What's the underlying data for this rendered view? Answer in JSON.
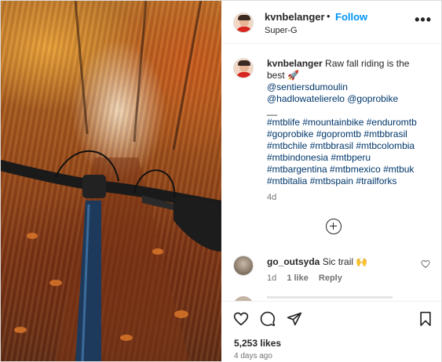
{
  "post": {
    "author": {
      "username": "kvnbelanger",
      "separator": "•",
      "follow_label": "Follow",
      "subtitle": "Super-G"
    },
    "more_icon": "more-options-icon",
    "caption": {
      "username": "kvnbelanger",
      "text": "Raw fall riding is the best 🚀",
      "mentions_line1": "@sentiersdumoulin",
      "mentions_line2": "@hadlowatelierelo @goprobike",
      "separator": "__",
      "hashtags": "#mtblife #mountainbike #enduromtb #goprobike #gopromtb #mtbbrasil #mtbchile #mtbbrasil #mtbcolombia #mtbindonesia #mtbperu #mtbargentina #mtbmexico #mtbuk #mtbitalia #mtbspain #trailforks",
      "time": "4d"
    },
    "load_more_icon": "plus-circle-icon",
    "comments": [
      {
        "username": "go_outsyda",
        "text": "Sic trail 🙌",
        "time": "1d",
        "likes": "1 like",
        "reply": "Reply"
      }
    ],
    "actions": {
      "like_icon": "heart-icon",
      "comment_icon": "comment-icon",
      "share_icon": "paper-plane-icon",
      "save_icon": "bookmark-icon"
    },
    "likes": "5,253 likes",
    "posted": "4 days ago"
  }
}
